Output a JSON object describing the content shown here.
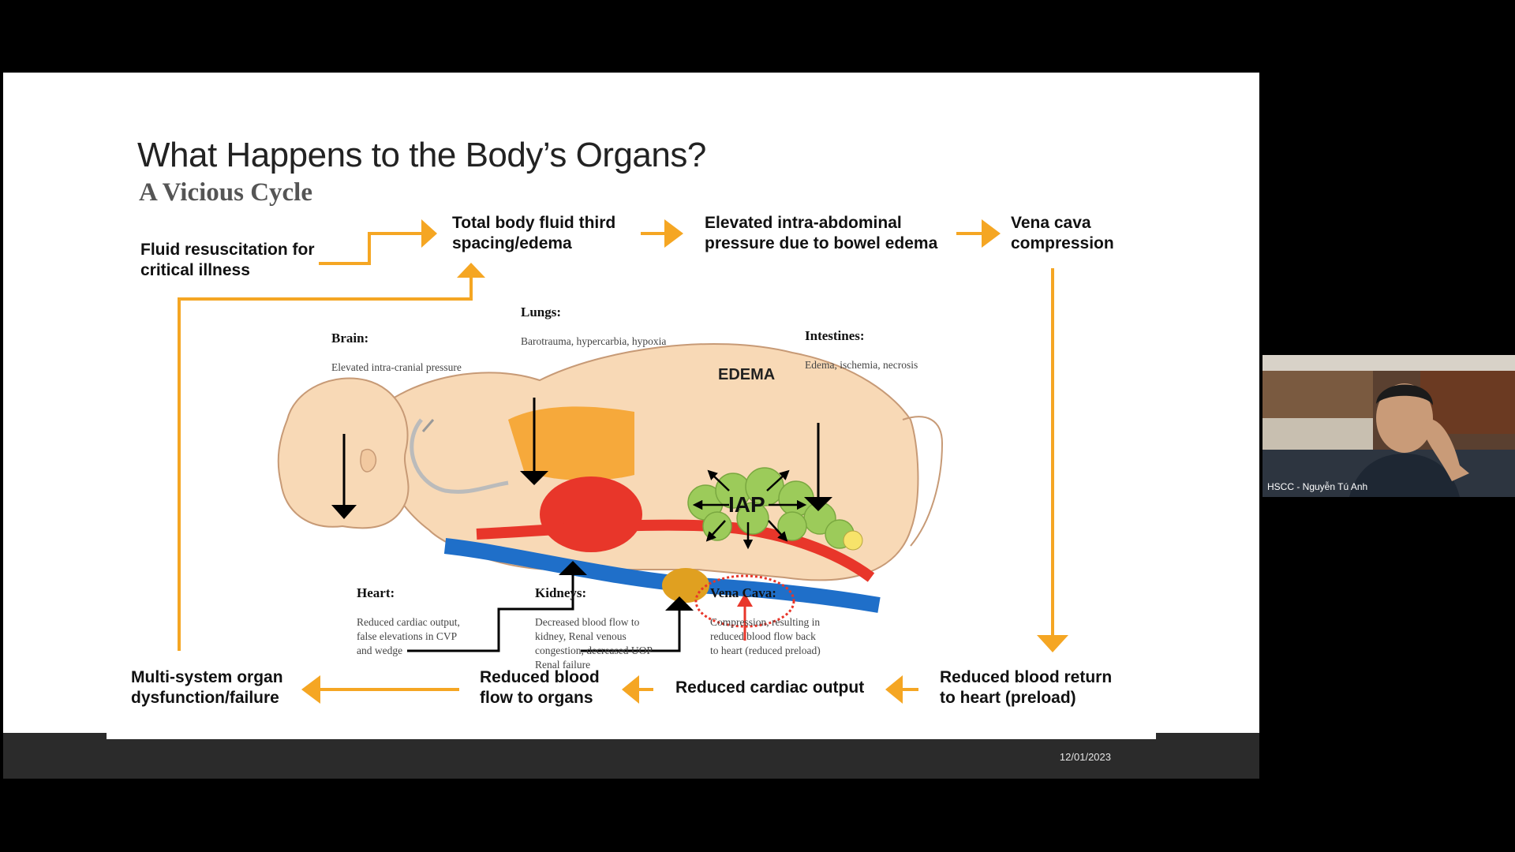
{
  "slide": {
    "title": "What Happens to the Body’s Organs?",
    "subtitle": "A Vicious Cycle",
    "footer_date": "12/01/2023"
  },
  "cycle": {
    "fluid_resuscitation": "Fluid resuscitation for\ncritical illness",
    "third_spacing": "Total body fluid third\nspacing/edema",
    "elevated_iap": "Elevated intra-abdominal\npressure due to bowel edema",
    "vena_cava_compression": "Vena cava\ncompression",
    "reduced_return": "Reduced blood return\nto heart (preload)",
    "reduced_output": "Reduced cardiac output",
    "reduced_flow": "Reduced blood\nflow to organs",
    "mods": "Multi-system organ\ndysfunction/failure"
  },
  "organs": {
    "brain": {
      "name": "Brain:",
      "desc": "Elevated intra-cranial pressure"
    },
    "lungs": {
      "name": "Lungs:",
      "desc": "Barotrauma, hypercarbia, hypoxia"
    },
    "intestines": {
      "name": "Intestines:",
      "desc": "Edema, ischemia, necrosis"
    },
    "heart": {
      "name": "Heart:",
      "desc": "Reduced cardiac output,\nfalse elevations in CVP\nand wedge"
    },
    "kidneys": {
      "name": "Kidneys:",
      "desc": "Decreased blood flow to\nkidney, Renal venous\ncongestion, decreased UOP\nRenal failure"
    },
    "vena_cava": {
      "name": "Vena Cava:",
      "desc": "Compression, resulting in\nreduced blood flow back\nto heart (reduced preload)"
    }
  },
  "figure": {
    "edema_label": "EDEMA",
    "iap_label": "IAP"
  },
  "video": {
    "participant_name": "HSCC - Nguyễn Tú Anh"
  },
  "colors": {
    "arrow_orange": "#F5A623",
    "artery_red": "#E8362A",
    "vein_blue": "#1F6FC9",
    "bowel_green": "#9CCB5A",
    "skin": "#F8D9B6"
  }
}
